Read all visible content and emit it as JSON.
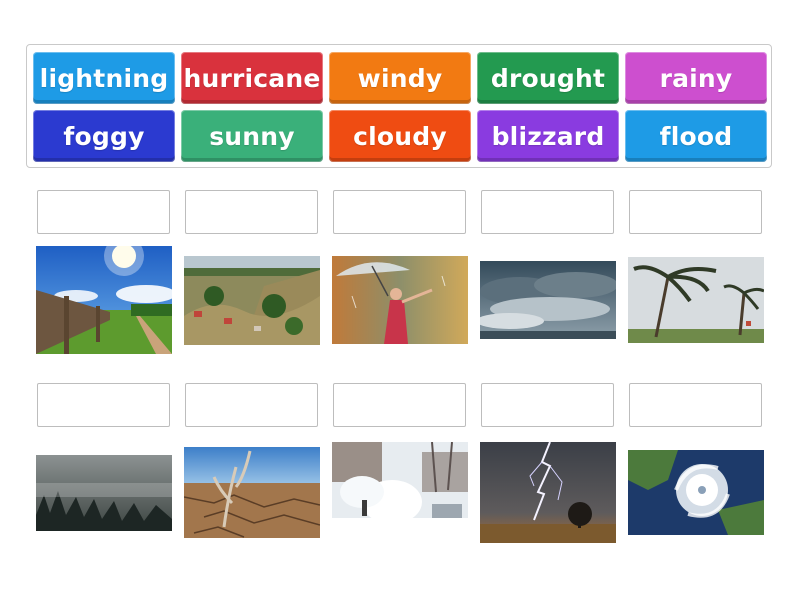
{
  "word_bank": {
    "tiles": [
      {
        "label": "lightning",
        "color": "#1e9be6"
      },
      {
        "label": "hurricane",
        "color": "#d9323d"
      },
      {
        "label": "windy",
        "color": "#f27a12"
      },
      {
        "label": "drought",
        "color": "#239a50"
      },
      {
        "label": "rainy",
        "color": "#cd4fcf"
      },
      {
        "label": "foggy",
        "color": "#2b3ad0"
      },
      {
        "label": "sunny",
        "color": "#3ab07a"
      },
      {
        "label": "cloudy",
        "color": "#ef4c12"
      },
      {
        "label": "blizzard",
        "color": "#8a3be0"
      },
      {
        "label": "flood",
        "color": "#1e9be6"
      }
    ]
  },
  "answer_slots": {
    "row1": [
      "",
      "",
      "",
      "",
      ""
    ],
    "row2": [
      "",
      "",
      "",
      "",
      ""
    ]
  },
  "images": {
    "row1": [
      "sunny-field-image",
      "flooded-town-image",
      "woman-umbrella-rain-image",
      "storm-clouds-image",
      "windy-palm-trees-image"
    ],
    "row2": [
      "foggy-forest-image",
      "cracked-drought-ground-image",
      "snow-blower-blizzard-image",
      "lightning-strike-image",
      "hurricane-satellite-image"
    ]
  }
}
